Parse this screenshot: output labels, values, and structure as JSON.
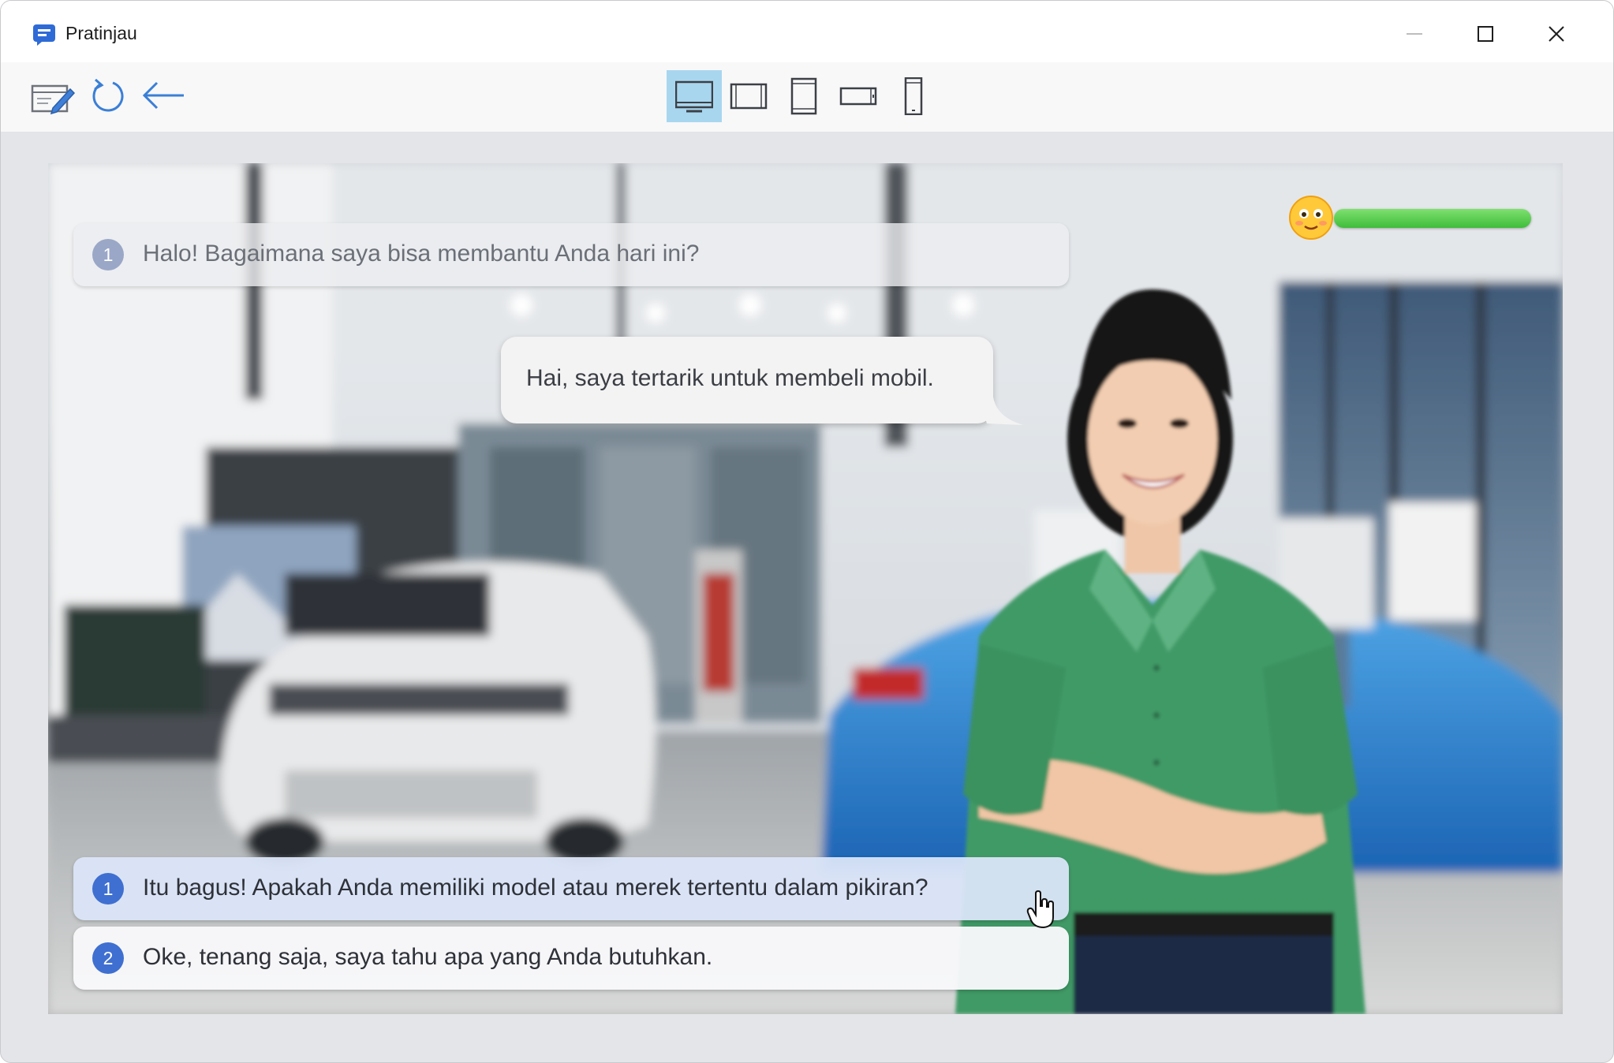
{
  "window": {
    "title": "Pratinjau",
    "controls": [
      "minimize-icon",
      "maximize-icon",
      "close-icon"
    ]
  },
  "toolbar": {
    "actions": [
      "edit-icon",
      "refresh-icon",
      "back-arrow-icon"
    ],
    "devices": [
      {
        "icon": "desktop-icon",
        "active": true
      },
      {
        "icon": "tablet-landscape-icon",
        "active": false
      },
      {
        "icon": "tablet-portrait-icon",
        "active": false
      },
      {
        "icon": "phone-landscape-icon",
        "active": false
      },
      {
        "icon": "phone-portrait-icon",
        "active": false
      }
    ]
  },
  "scene": {
    "emotion_meter": {
      "icon": "smiley-face-icon",
      "level": 1.0,
      "color": "#4cc744"
    },
    "question": {
      "number": "1",
      "text": "Halo! Bagaimana saya bisa membantu Anda hari ini?"
    },
    "reply": {
      "text": "Hai, saya tertarik untuk membeli mobil."
    },
    "options": [
      {
        "number": "1",
        "text": "Itu bagus! Apakah Anda memiliki model atau merek tertentu dalam pikiran?",
        "hovered": true
      },
      {
        "number": "2",
        "text": "Oke, tenang saja, saya tahu apa yang Anda butuhkan.",
        "hovered": false
      }
    ]
  },
  "colors": {
    "accent": "#3f6fd0",
    "active_device_bg": "#a9d6ef",
    "app_icon": "#2f6bd6"
  }
}
